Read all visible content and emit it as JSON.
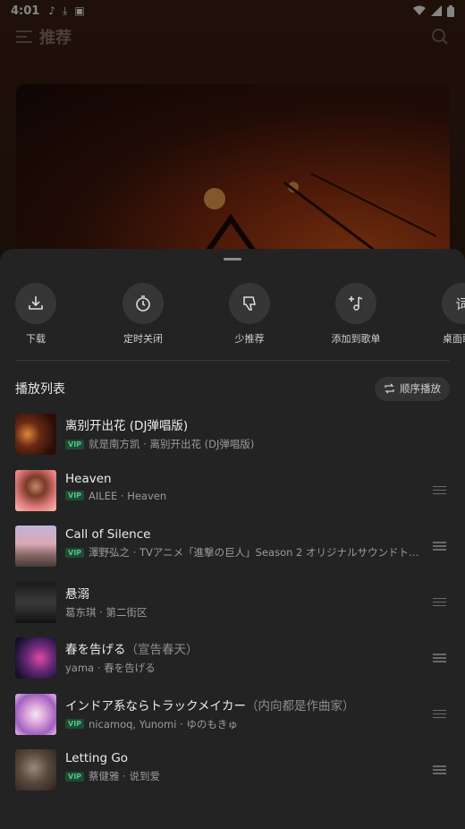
{
  "status": {
    "time": "4:01",
    "left_icons": [
      "tiktok-icon",
      "download-icon",
      "notification-app-icon"
    ],
    "right_icons": [
      "wifi-icon",
      "signal-icon",
      "battery-icon"
    ]
  },
  "topbar": {
    "title": "推荐"
  },
  "sheet": {
    "actions": [
      {
        "label": "下载",
        "icon": "download-icon"
      },
      {
        "label": "定时关闭",
        "icon": "timer-icon"
      },
      {
        "label": "少推荐",
        "icon": "thumbs-down-icon"
      },
      {
        "label": "添加到歌单",
        "icon": "add-to-playlist-icon"
      },
      {
        "label": "桌面歌词",
        "icon": "lyrics-icon"
      }
    ],
    "playlist_header": "播放列表",
    "order_label": "顺序播放",
    "songs": [
      {
        "title": "离别开出花 (DJ弹唱版)",
        "subtitle": "",
        "vip": true,
        "artist_album": "就是南方凯 · 离别开出花 (DJ弹唱版)"
      },
      {
        "title": "Heaven",
        "subtitle": "",
        "vip": true,
        "artist_album": "AILEE · Heaven"
      },
      {
        "title": "Call of Silence",
        "subtitle": "",
        "vip": true,
        "artist_album": "澤野弘之 · TVアニメ「進撃の巨人」Season 2 オリジナルサウンドトラ..."
      },
      {
        "title": "悬溺",
        "subtitle": "",
        "vip": false,
        "artist_album": "葛东琪 · 第二街区"
      },
      {
        "title": "春を告げる",
        "subtitle": "（宣告春天）",
        "vip": false,
        "artist_album": "yama · 春を告げる"
      },
      {
        "title": "インドア系ならトラックメイカー",
        "subtitle": "（内向都是作曲家）",
        "vip": true,
        "artist_album": "nicamoq, Yunomi · ゆのもきゅ"
      },
      {
        "title": "Letting Go",
        "subtitle": "",
        "vip": true,
        "artist_album": "蔡健雅 · 说到爱"
      }
    ],
    "vip_label": "VIP"
  }
}
